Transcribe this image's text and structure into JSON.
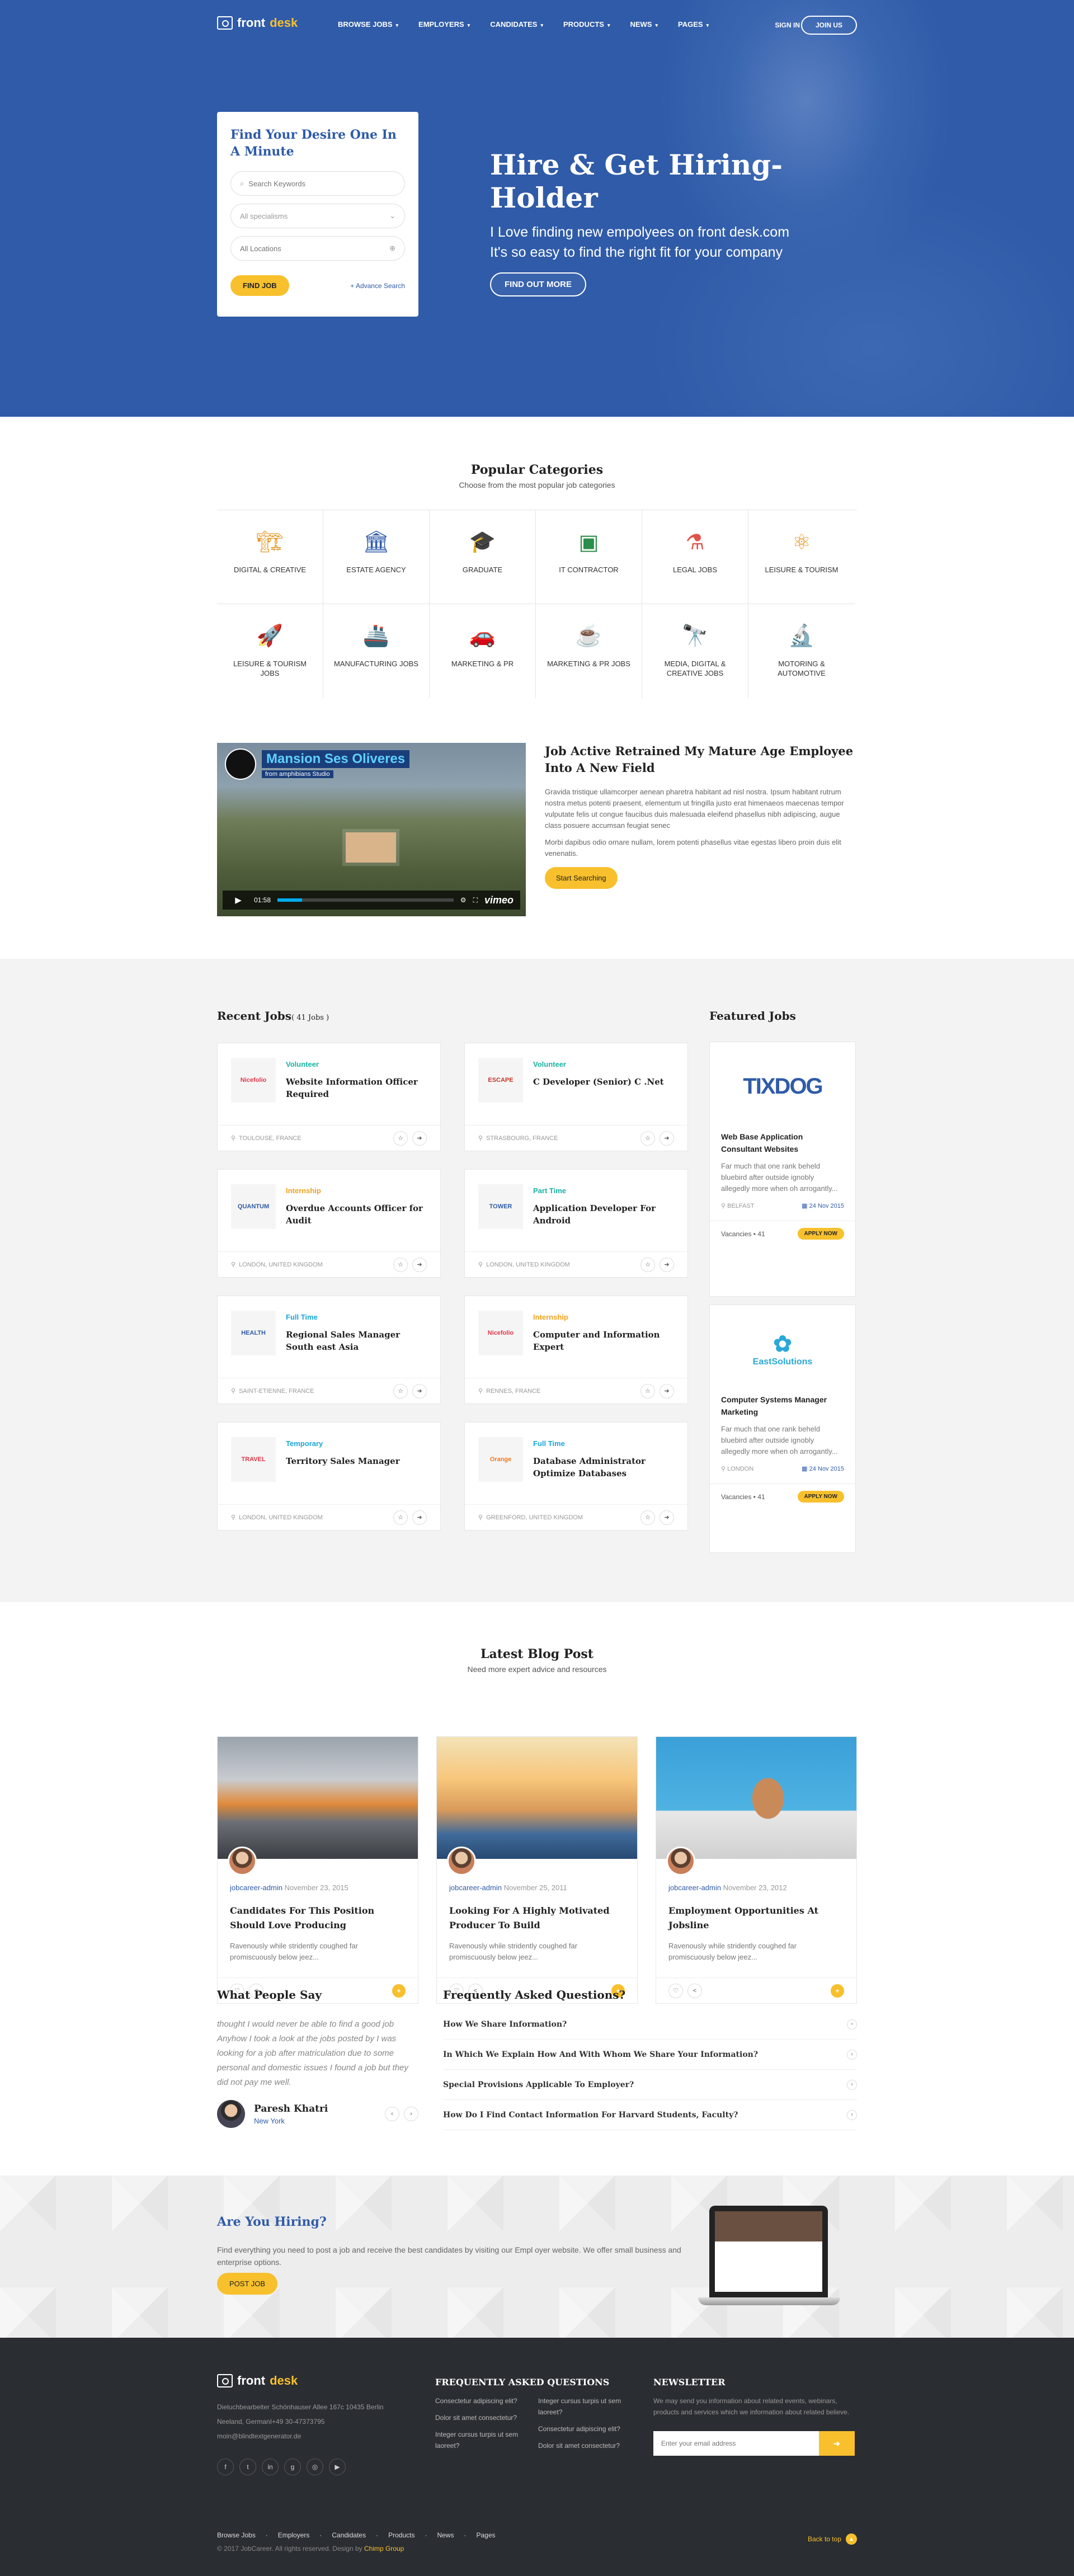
{
  "header": {
    "logo_prefix": "front",
    "logo_suffix": "desk",
    "nav": [
      "BROWSE JOBS",
      "EMPLOYERS",
      "CANDIDATES",
      "PRODUCTS",
      "NEWS",
      "PAGES"
    ],
    "signin": "SIGN IN",
    "joinus": "JOIN US"
  },
  "search": {
    "title": "Find Your Desire One In A Minute",
    "keywords_placeholder": "Search Keywords",
    "specialisms": "All specialisms",
    "locations_placeholder": "All Locations",
    "find_button": "FIND JOB",
    "advance": "+ Advance Search"
  },
  "hero": {
    "title": "Hire & Get Hiring-Holder",
    "line1": "I Love finding new empolyees on front desk.com",
    "line2": "It's so easy to find the right fit for your company",
    "button": "FIND OUT MORE"
  },
  "categories": {
    "title": "Popular Categories",
    "subtitle": "Choose from the most popular job categories",
    "items": [
      {
        "label": "DIGITAL & CREATIVE",
        "icon": "crane-icon"
      },
      {
        "label": "ESTATE AGENCY",
        "icon": "building-icon"
      },
      {
        "label": "GRADUATE",
        "icon": "graduate-icon"
      },
      {
        "label": "IT CONTRACTOR",
        "icon": "code-monitor-icon"
      },
      {
        "label": "LEGAL JOBS",
        "icon": "flask-icon"
      },
      {
        "label": "LEISURE & TOURISM",
        "icon": "atom-icon"
      },
      {
        "label": "LEISURE & TOURISM JOBS",
        "icon": "rocket-icon"
      },
      {
        "label": "MANUFACTURING JOBS",
        "icon": "ship-icon"
      },
      {
        "label": "MARKETING & PR",
        "icon": "car-icon"
      },
      {
        "label": "MARKETING & PR JOBS",
        "icon": "coffee-icon"
      },
      {
        "label": "MEDIA, DIGITAL & CREATIVE JOBS",
        "icon": "telescope-icon"
      },
      {
        "label": "MOTORING & AUTOMOTIVE",
        "icon": "microscope-icon"
      }
    ]
  },
  "video": {
    "name": "Mansion Ses Oliveres",
    "from": "from amphibians Studio",
    "time": "01:58",
    "brand": "vimeo"
  },
  "job_active": {
    "title": "Job Active Retrained My Mature Age Employee Into A New Field",
    "p1": "Gravida tristique ullamcorper aenean pharetra habitant ad nisl nostra. Ipsum habitant rutrum nostra metus potenti praesent, elementum ut fringilla justo erat himenaeos maecenas tempor vulputate felis ut congue faucibus duis malesuada eleifend phasellus nibh adipiscing, augue class posuere accumsan feugiat senec",
    "p2": "Morbi dapibus odio ornare nullam, lorem potenti phasellus vitae egestas libero proin duis elit venenatis.",
    "button": "Start Searching"
  },
  "recent_jobs": {
    "title": "Recent Jobs",
    "count": "( 41 Jobs )",
    "items": [
      {
        "type": "Volunteer",
        "color": "#1bb3a3",
        "title": "Website Information Officer Required",
        "loc": "TOULOUSE, FRANCE",
        "logo": "Nicefolio",
        "logo_color": "#e0384a"
      },
      {
        "type": "Volunteer",
        "color": "#1bb3a3",
        "title": "C Developer (Senior) C .Net",
        "loc": "STRASBOURG, FRANCE",
        "logo": "ESCAPE",
        "logo_color": "#c0392b"
      },
      {
        "type": "Internship",
        "color": "#f0a21e",
        "title": "Overdue Accounts Officer for Audit",
        "loc": "LONDON, UNITED KINGDOM",
        "logo": "QUANTUM",
        "logo_color": "#2f5ba8"
      },
      {
        "type": "Part Time",
        "color": "#1bb3a3",
        "title": "Application Developer For Android",
        "loc": "LONDON, UNITED KINGDOM",
        "logo": "TOWER",
        "logo_color": "#2f5ba8"
      },
      {
        "type": "Full Time",
        "color": "#1aa6d8",
        "title": "Regional Sales Manager South east Asia",
        "loc": "SAINT-ETIENNE, FRANCE",
        "logo": "HEALTH",
        "logo_color": "#2f5ba8"
      },
      {
        "type": "Internship",
        "color": "#f0a21e",
        "title": "Computer and Information Expert",
        "loc": "RENNES, FRANCE",
        "logo": "Nicefolio",
        "logo_color": "#e0384a"
      },
      {
        "type": "Temporary",
        "color": "#1aa6d8",
        "title": "Territory Sales Manager",
        "loc": "LONDON, UNITED KINGDOM",
        "logo": "TRAVEL",
        "logo_color": "#e0384a"
      },
      {
        "type": "Full Time",
        "color": "#1aa6d8",
        "title": "Database Administrator Optimize Databases",
        "loc": "GREENFORD, UNITED KINGDOM",
        "logo": "Orange",
        "logo_color": "#f07a1e"
      }
    ]
  },
  "featured": {
    "title": "Featured Jobs",
    "items": [
      {
        "logo": "TIXDOG",
        "logo_color": "#2f5ba8",
        "title": "Web Base Application Consultant Websites",
        "desc": "Far much that one rank beheld bluebird after outside ignobly allegedly more when oh arrogantly...",
        "loc": "BELFAST",
        "date": "24 Nov 2015",
        "vacancies": "Vacancies • 41",
        "apply": "APPLY NOW"
      },
      {
        "logo": "EastSolutions",
        "logo_color": "#2aa8d8",
        "title": "Computer Systems Manager Marketing",
        "desc": "Far much that one rank beheld bluebird after outside ignobly allegedly more when oh arrogantly...",
        "loc": "LONDON",
        "date": "24 Nov 2015",
        "vacancies": "Vacancies • 41",
        "apply": "APPLY NOW"
      }
    ]
  },
  "blog": {
    "title": "Latest Blog Post",
    "subtitle": "Need more expert advice and resources",
    "posts": [
      {
        "author": "jobcareer-admin",
        "date": "November 23, 2015",
        "title": "Candidates For This Position Should Love Producing",
        "excerpt": "Ravenously while stridently coughed far promiscuously below jeez..."
      },
      {
        "author": "jobcareer-admin",
        "date": "November 25, 2011",
        "title": "Looking For A Highly Motivated Producer To Build",
        "excerpt": "Ravenously while stridently coughed far promiscuously below jeez..."
      },
      {
        "author": "jobcareer-admin",
        "date": "November 23, 2012",
        "title": "Employment Opportunities At Jobsline",
        "excerpt": "Ravenously while stridently coughed far promiscuously below jeez..."
      }
    ]
  },
  "people": {
    "title": "What People Say",
    "quote": "thought I would never be able to find a good job Anyhow I took a look at the jobs posted by I was looking for a job after matriculation due to some personal and domestic issues I found a job but they did not pay me well.",
    "name": "Paresh Khatri",
    "city": "New York"
  },
  "faq": {
    "title": "Frequently Asked Questions?",
    "items": [
      "How We Share Information?",
      "In Which We Explain How And With Whom We Share Your Information?",
      "Special Provisions Applicable To Employer?",
      "How Do I Find Contact Information For Harvard Students, Faculty?"
    ]
  },
  "hiring": {
    "title": "Are You Hiring?",
    "text": "Find everything you need to post a job and receive the best candidates by visiting our Empl oyer website. We offer small business and enterprise options.",
    "button": "POST JOB"
  },
  "footer": {
    "address1": "Dieluchbearbeiter Schönhauser Allee 167c 10435 Berlin",
    "address2": "Neeland, GermanI+49 30-47373795",
    "email": "moin@blindtextgenerator.de",
    "faq_title": "FREQUENTLY ASKED QUESTIONS",
    "faq_left": [
      "Consectetur adipiscing elit?",
      "Dolor sit amet consectetur?",
      "Integer cursus turpis ut sem laoreet?"
    ],
    "faq_right": [
      "Integer cursus turpis ut sem laoreet?",
      "Consectetur adipiscing elit?",
      "Dolor sit amet consectetur?"
    ],
    "nl_title": "NEWSLETTER",
    "nl_text": "We may send you information about related events, webinars, products and services which we information about related believe.",
    "nl_placeholder": "Enter your email address",
    "links": [
      "Browse Jobs",
      "Employers",
      "Candidates",
      "Products",
      "News",
      "Pages"
    ],
    "copy_prefix": "© 2017 JobCareer. All rights reserved. Design by",
    "copy_brand": "Chimp Group",
    "back_top": "Back to top"
  }
}
